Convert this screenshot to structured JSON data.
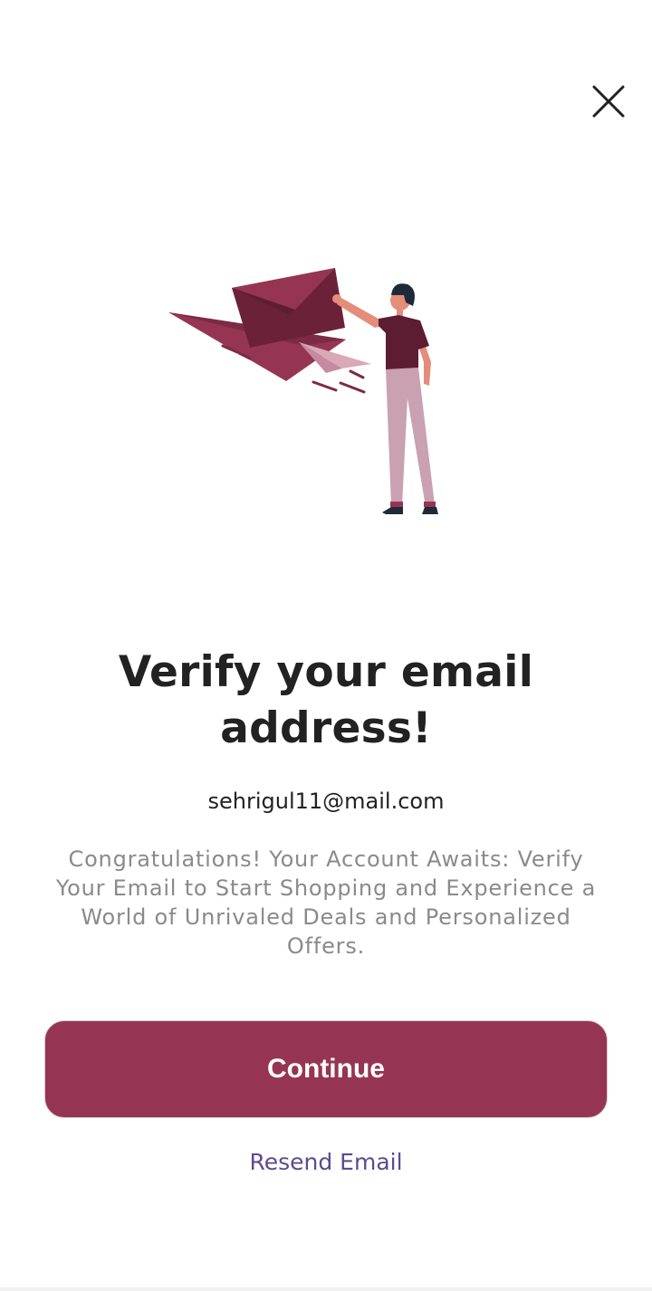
{
  "dialog": {
    "title": "Verify your email address!",
    "email": "sehrigul11@mail.com",
    "description": "Congratulations! Your Account Awaits: Verify Your Email to Start Shopping and Experience a World of Unrivaled Deals and Personalized Offers.",
    "continue_label": "Continue",
    "resend_label": "Resend Email",
    "close_icon": "close-icon",
    "illustration": "person-sending-email-illustration"
  },
  "colors": {
    "primary": "#963553",
    "link": "#5d4b8e",
    "title": "#222222",
    "description": "#8a8a8a"
  }
}
